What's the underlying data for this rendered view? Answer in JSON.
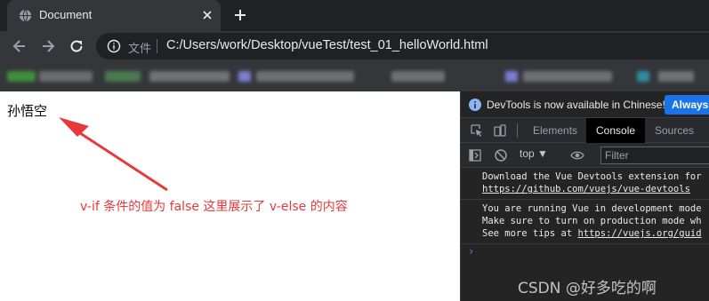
{
  "browser": {
    "tab": {
      "title": "Document"
    },
    "secure_label": "文件",
    "url": "C:/Users/work/Desktop/vueTest/test_01_helloWorld.html"
  },
  "page": {
    "rendered_text": "孙悟空",
    "annotation": "v-if 条件的值为 false 这里展示了 v-else 的内容",
    "annotation_color": "#e8393a"
  },
  "devtools": {
    "infobar_text": "DevTools is now available in Chinese!",
    "infobar_button": "Always m",
    "tabs": [
      {
        "label": "Elements",
        "active": false
      },
      {
        "label": "Console",
        "active": true
      },
      {
        "label": "Sources",
        "active": false
      }
    ],
    "context": "top ▼",
    "filter_placeholder": "Filter",
    "messages": [
      {
        "lines": [
          "Download the Vue Devtools extension for",
          "https://github.com/vuejs/vue-devtools"
        ]
      },
      {
        "lines": [
          "You are running Vue in development mode",
          "Make sure to turn on production mode wh"
        ],
        "tip_prefix": "See more tips at ",
        "tip_link": "https://vuejs.org/guid"
      }
    ],
    "prompt": "›"
  },
  "watermark": "CSDN @好多吃的啊",
  "icons": [
    "globe-icon",
    "close-icon",
    "plus-icon",
    "back-icon",
    "forward-icon",
    "reload-icon",
    "info-icon",
    "inspect-icon",
    "device-icon",
    "sidebar-icon",
    "block-icon",
    "eye-icon"
  ]
}
